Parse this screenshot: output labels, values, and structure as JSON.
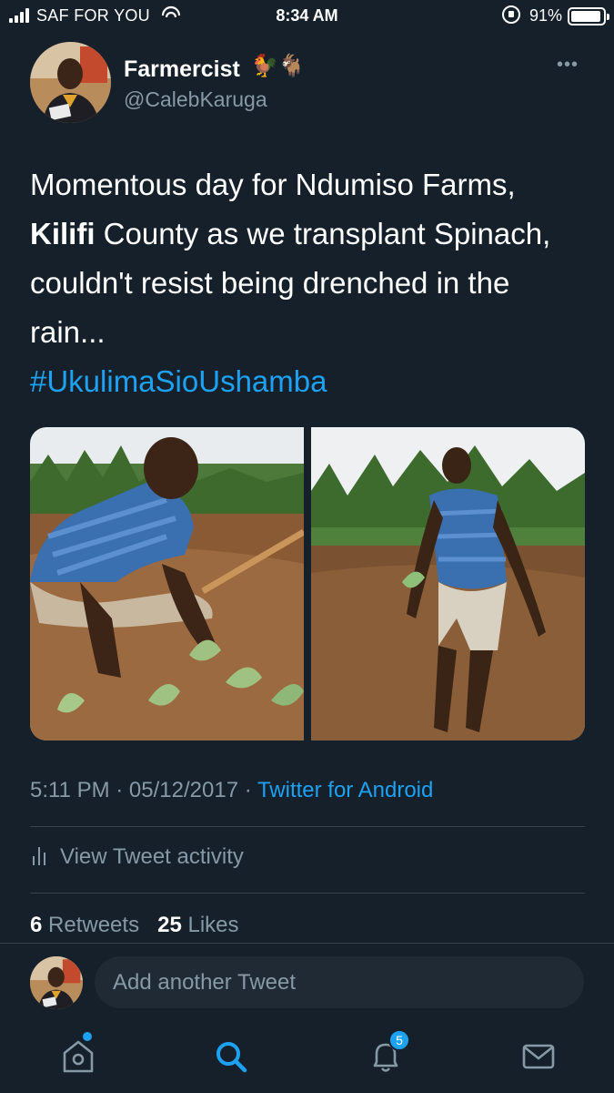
{
  "status_bar": {
    "carrier": "SAF FOR YOU",
    "time": "8:34 AM",
    "battery": "91%"
  },
  "tweet": {
    "display_name": "Farmercist",
    "name_emojis": "🐓🐐",
    "handle": "@CalebKaruga",
    "text_line1": "Momentous day for Ndumiso Farms,",
    "text_bold": "Kilifi",
    "text_line2_rest": " County as we transplant Spinach,",
    "text_line3": "couldn't resist being drenched in the",
    "text_line4": "rain...",
    "hashtag": "#UkulimaSioUshamba",
    "timestamp": "5:11 PM · 05/12/2017 · ",
    "source": "Twitter for Android",
    "activity_label": "View Tweet activity",
    "retweets_count": "6",
    "retweets_label": " Retweets",
    "likes_count": "25",
    "likes_label": " Likes"
  },
  "reply": {
    "placeholder": "Add another Tweet"
  },
  "tab_bar": {
    "notifications_count": "5",
    "tabs": [
      "home-icon",
      "search-icon",
      "bell-icon",
      "mail-icon"
    ]
  },
  "colors": {
    "background": "#15202b",
    "accent": "#1da1f2",
    "muted": "#8899a6",
    "divider": "#38444d"
  }
}
